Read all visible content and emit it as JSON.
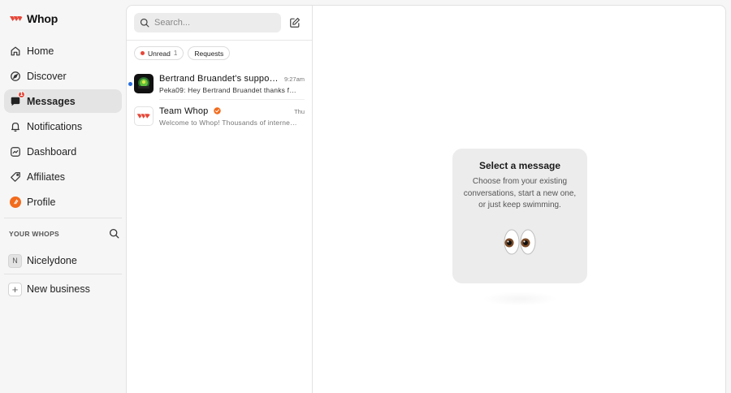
{
  "app": {
    "name": "Whop",
    "brand_color": "#e5483a"
  },
  "sidebar": {
    "items": [
      {
        "label": "Home",
        "icon": "home-icon"
      },
      {
        "label": "Discover",
        "icon": "compass-icon"
      },
      {
        "label": "Messages",
        "icon": "chat-icon",
        "badge": "1",
        "active": true
      },
      {
        "label": "Notifications",
        "icon": "bell-icon"
      },
      {
        "label": "Dashboard",
        "icon": "dashboard-icon"
      },
      {
        "label": "Affiliates",
        "icon": "tag-icon"
      },
      {
        "label": "Profile",
        "icon": "profile-icon"
      }
    ],
    "whops_header": "YOUR WHOPS",
    "whops": [
      {
        "initial": "N",
        "label": "Nicelydone"
      }
    ],
    "new_business": "New business"
  },
  "messages": {
    "search_placeholder": "Search...",
    "filters": {
      "unread_label": "Unread",
      "unread_count": "1",
      "requests_label": "Requests"
    },
    "conversations": [
      {
        "title": "Bertrand Bruandet's support …",
        "time": "9:27am",
        "preview": "Peka09: Hey Bertrand Bruandet thanks f…",
        "unread": true
      },
      {
        "title": "Team Whop",
        "time": "Thu",
        "preview": "Welcome to Whop! Thousands of interne…",
        "unread": false,
        "verified": true
      }
    ]
  },
  "empty_state": {
    "title": "Select a message",
    "body": "Choose from your existing conversations, start a new one, or just keep swimming."
  }
}
